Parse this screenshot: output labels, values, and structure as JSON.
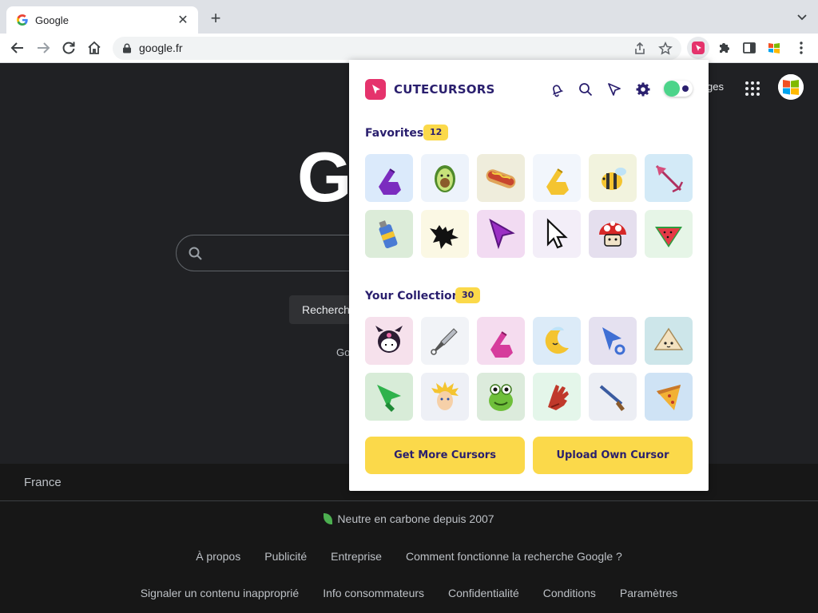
{
  "browser": {
    "tab_title": "Google",
    "new_tab_label": "+",
    "url": "google.fr"
  },
  "google": {
    "logo_letter": "G",
    "search_button": "Recherch",
    "offered_in": "Go",
    "header_link": "ges",
    "country": "France",
    "carbon": "Neutre en carbone depuis 2007",
    "footer_links_1": [
      "À propos",
      "Publicité",
      "Entreprise",
      "Comment fonctionne la recherche Google ?"
    ],
    "footer_links_2": [
      "Signaler un contenu inapproprié",
      "Info consommateurs",
      "Confidentialité",
      "Conditions",
      "Paramètres"
    ]
  },
  "popup": {
    "brand": "CUTECURSORS",
    "header_icons": [
      "bell-icon",
      "search-icon",
      "cursor-icon",
      "gear-icon"
    ],
    "toggle_on": true,
    "favorites": {
      "title": "Favorites",
      "count": "12",
      "items": [
        {
          "name": "purple-foam-finger",
          "bg": "#dbeafb"
        },
        {
          "name": "avocado",
          "bg": "#edf3fb"
        },
        {
          "name": "hotdog",
          "bg": "#efeddc"
        },
        {
          "name": "yellow-foam-finger",
          "bg": "#f2f6fc"
        },
        {
          "name": "bee",
          "bg": "#f2f3de"
        },
        {
          "name": "pink-arrow",
          "bg": "#d3eaf7"
        },
        {
          "name": "spray-can",
          "bg": "#dcecd9"
        },
        {
          "name": "bat",
          "bg": "#fbf8e4"
        },
        {
          "name": "purple-arrow",
          "bg": "#f2dbf2"
        },
        {
          "name": "pixel-arrow",
          "bg": "#f3eef8"
        },
        {
          "name": "mushroom",
          "bg": "#e5dfee"
        },
        {
          "name": "watermelon",
          "bg": "#e6f5e7"
        }
      ]
    },
    "collection": {
      "title": "Your Collection",
      "count": "30",
      "items": [
        {
          "name": "kuromi",
          "bg": "#f6e1ec"
        },
        {
          "name": "kunai",
          "bg": "#f1f3f7"
        },
        {
          "name": "pink-foam-finger",
          "bg": "#f5dcef"
        },
        {
          "name": "moon",
          "bg": "#dcebf8"
        },
        {
          "name": "blue-arrow-ring",
          "bg": "#e5e1f0"
        },
        {
          "name": "dumpling",
          "bg": "#cde6ea"
        },
        {
          "name": "green-arrow",
          "bg": "#d8ecd8"
        },
        {
          "name": "naruto",
          "bg": "#eef0f6"
        },
        {
          "name": "om-nom",
          "bg": "#dcebdc"
        },
        {
          "name": "red-glove",
          "bg": "#e4f6ea"
        },
        {
          "name": "shotgun",
          "bg": "#eceef4"
        },
        {
          "name": "pizza",
          "bg": "#cfe3f5"
        }
      ]
    },
    "buttons": {
      "get_more": "Get More Cursors",
      "upload": "Upload Own Cursor"
    },
    "colors": {
      "brand": "#e5336c",
      "navy": "#2a1f6e",
      "yellow": "#fbd94a",
      "toggle": "#4cd48a"
    }
  }
}
